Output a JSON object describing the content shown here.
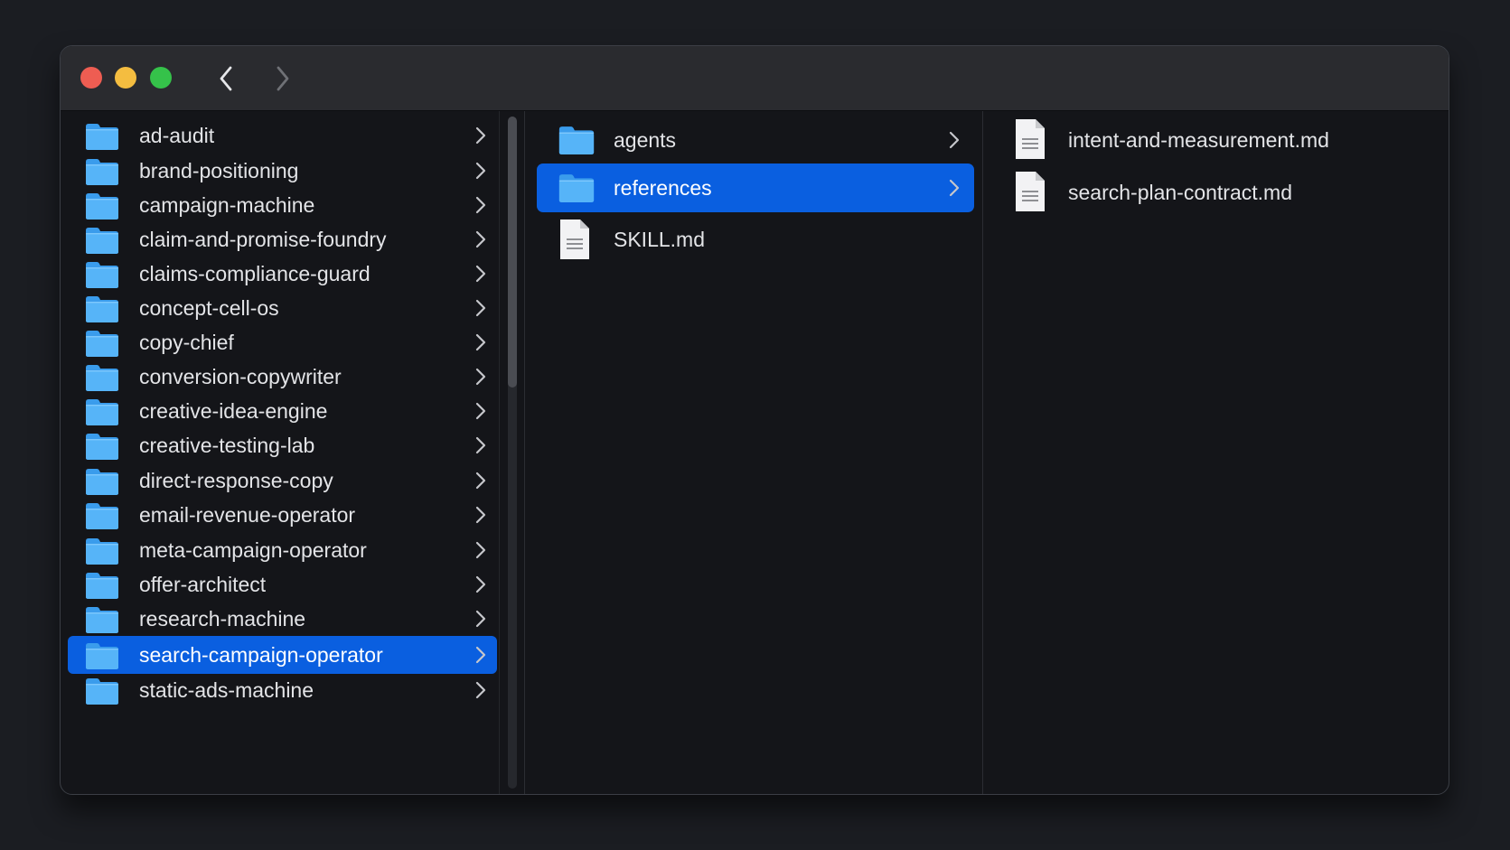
{
  "titlebar": {
    "back_icon": "chevron-left-icon",
    "forward_icon": "chevron-right-icon"
  },
  "column1": {
    "items": [
      {
        "label": "ad-audit",
        "type": "folder"
      },
      {
        "label": "brand-positioning",
        "type": "folder"
      },
      {
        "label": "campaign-machine",
        "type": "folder"
      },
      {
        "label": "claim-and-promise-foundry",
        "type": "folder"
      },
      {
        "label": "claims-compliance-guard",
        "type": "folder"
      },
      {
        "label": "concept-cell-os",
        "type": "folder"
      },
      {
        "label": "copy-chief",
        "type": "folder"
      },
      {
        "label": "conversion-copywriter",
        "type": "folder"
      },
      {
        "label": "creative-idea-engine",
        "type": "folder"
      },
      {
        "label": "creative-testing-lab",
        "type": "folder"
      },
      {
        "label": "direct-response-copy",
        "type": "folder"
      },
      {
        "label": "email-revenue-operator",
        "type": "folder"
      },
      {
        "label": "meta-campaign-operator",
        "type": "folder"
      },
      {
        "label": "offer-architect",
        "type": "folder"
      },
      {
        "label": "research-machine",
        "type": "folder"
      },
      {
        "label": "search-campaign-operator",
        "type": "folder",
        "selected": true
      },
      {
        "label": "static-ads-machine",
        "type": "folder"
      }
    ]
  },
  "column2": {
    "items": [
      {
        "label": "agents",
        "type": "folder"
      },
      {
        "label": "references",
        "type": "folder",
        "selected": true
      },
      {
        "label": "SKILL.md",
        "type": "file"
      }
    ]
  },
  "column3": {
    "items": [
      {
        "label": "intent-and-measurement.md",
        "type": "file"
      },
      {
        "label": "search-plan-contract.md",
        "type": "file"
      }
    ]
  },
  "colors": {
    "selection": "#0a5fe0",
    "folder": "#4aa8f5",
    "window_bg": "#141519",
    "titlebar_bg": "#2a2b2f"
  }
}
